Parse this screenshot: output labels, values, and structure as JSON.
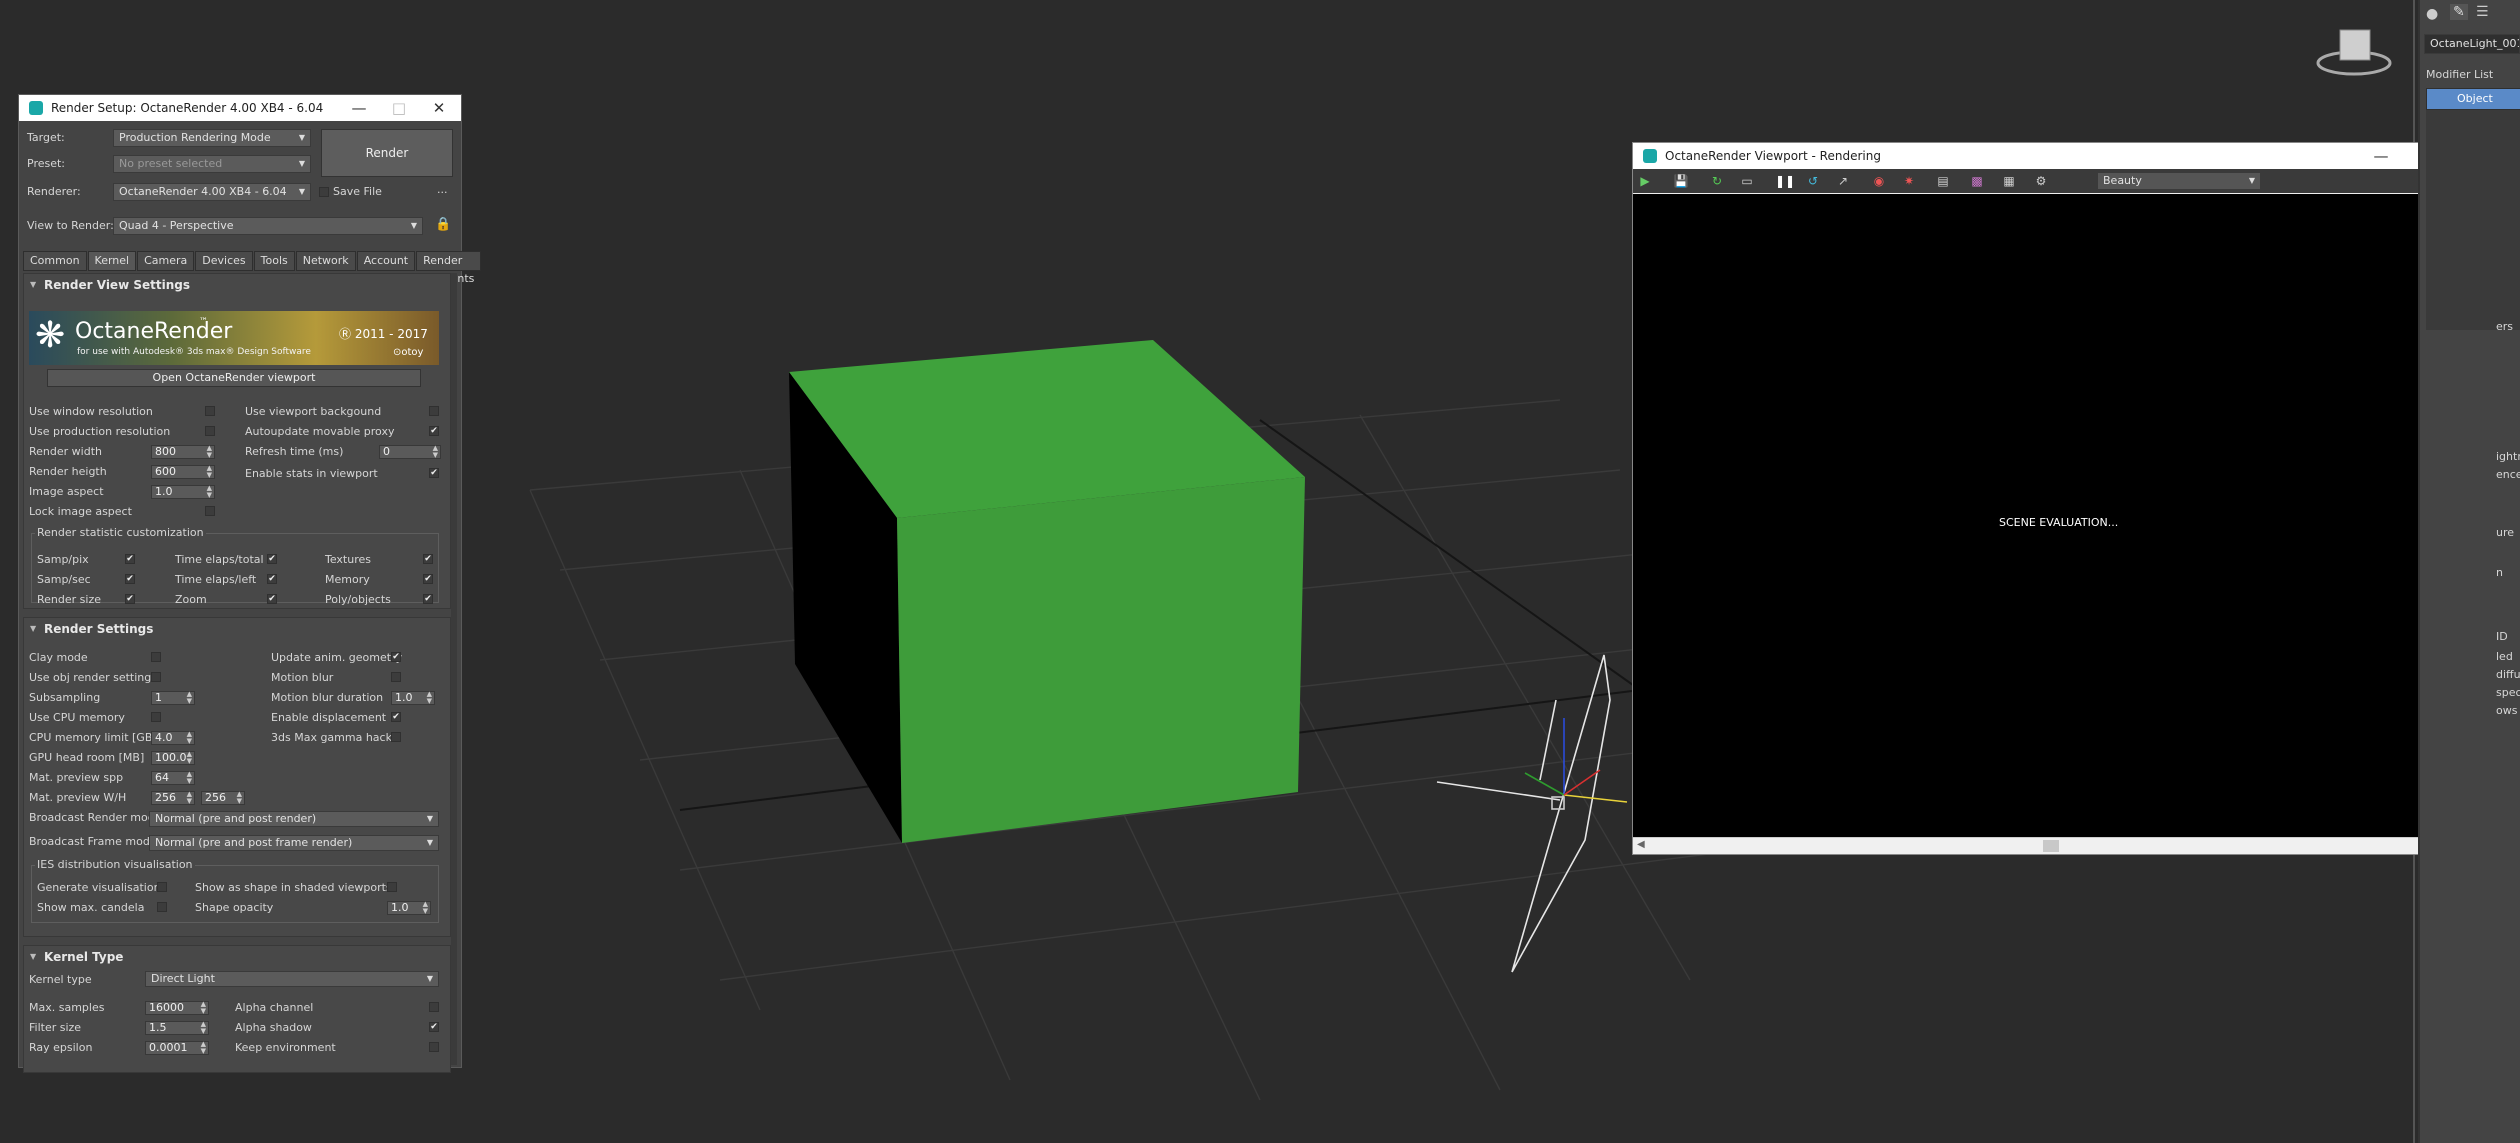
{
  "render_setup": {
    "title": "Render Setup: OctaneRender 4.00 XB4 - 6.04",
    "target_label": "Target:",
    "target_value": "Production Rendering Mode",
    "preset_label": "Preset:",
    "preset_value": "No preset selected",
    "renderer_label": "Renderer:",
    "renderer_value": "OctaneRender 4.00 XB4 - 6.04",
    "save_file": "Save File",
    "more": "...",
    "view_label": "View to Render:",
    "view_value": "Quad 4 - Perspective",
    "render_button": "Render",
    "tabs": [
      "Common",
      "Kernel",
      "Camera",
      "Devices",
      "Tools",
      "Network",
      "Account",
      "Render Elements"
    ],
    "active_tab": "Kernel",
    "render_view": {
      "heading": "Render View Settings",
      "banner_brand": "OctaneRender",
      "banner_tm": "™",
      "banner_sub": "for use with Autodesk® 3ds max® Design Software",
      "banner_years": "Ⓡ 2011 - 2017",
      "banner_otoy": "⊙otoy",
      "open_viewport": "Open OctaneRender viewport",
      "use_window_resolution": "Use window resolution",
      "use_production_resolution": "Use production resolution",
      "render_width": "Render width",
      "render_width_value": "800",
      "render_height": "Render heigth",
      "render_height_value": "600",
      "image_aspect": "Image aspect",
      "image_aspect_value": "1.0",
      "lock_image_aspect": "Lock image aspect",
      "use_viewport_background": "Use viewport backgound",
      "autoupdate_proxy": "Autoupdate movable proxy",
      "refresh_time": "Refresh time (ms)",
      "refresh_time_value": "0",
      "enable_stats": "Enable stats in viewport",
      "stats_group": "Render statistic customization",
      "stats": [
        [
          "Samp/pix",
          "Time elaps/total",
          "Textures"
        ],
        [
          "Samp/sec",
          "Time elaps/left",
          "Memory"
        ],
        [
          "Render size",
          "Zoom",
          "Poly/objects"
        ]
      ]
    },
    "render_settings": {
      "heading": "Render Settings",
      "clay_mode": "Clay mode",
      "use_obj_render": "Use obj render settings",
      "subsampling": "Subsampling",
      "subsampling_value": "1",
      "use_cpu_memory": "Use CPU memory",
      "cpu_memory_limit": "CPU memory limit [GB]",
      "cpu_memory_limit_value": "4.0",
      "gpu_headroom": "GPU head room [MB]",
      "gpu_headroom_value": "100.0",
      "mat_preview_spp": "Mat. preview spp",
      "mat_preview_spp_value": "64",
      "mat_preview_wh": "Mat. preview W/H",
      "mat_preview_w": "256",
      "mat_preview_h": "256",
      "update_anim": "Update anim. geometry",
      "motion_blur": "Motion blur",
      "motion_blur_duration": "Motion blur duration",
      "motion_blur_duration_value": "1.0",
      "enable_displacement": "Enable displacement",
      "gamma_hack": "3ds Max gamma hack",
      "broadcast_render_label": "Broadcast Render mode",
      "broadcast_render_value": "Normal (pre and post render)",
      "broadcast_frame_label": "Broadcast Frame mode",
      "broadcast_frame_value": "Normal (pre and post frame render)",
      "ies_group": "IES distribution visualisation",
      "generate_vis": "Generate visualisation",
      "show_shape": "Show as shape in shaded viewports",
      "show_candela": "Show max. candela",
      "shape_opacity": "Shape opacity",
      "shape_opacity_value": "1.0"
    },
    "kernel_type": {
      "heading": "Kernel Type",
      "kernel_label": "Kernel type",
      "kernel_value": "Direct Light",
      "max_samples": "Max. samples",
      "max_samples_value": "16000",
      "filter_size": "Filter size",
      "filter_size_value": "1.5",
      "ray_epsilon": "Ray epsilon",
      "ray_epsilon_value": "0.0001",
      "alpha_channel": "Alpha channel",
      "alpha_shadow": "Alpha shadow",
      "keep_environment": "Keep environment"
    }
  },
  "octane_viewport": {
    "title": "OctaneRender Viewport - Rendering",
    "pass_value": "Beauty",
    "status": "SCENE EVALUATION..."
  },
  "command_panel": {
    "object_name": "OctaneLight_001",
    "modifier_list": "Modifier List",
    "stack_item": "Object",
    "partial_labels": [
      "ers",
      "ightn",
      "ence p",
      "ure",
      "n",
      "ID",
      "led",
      "diffus",
      "specu",
      "ows"
    ]
  },
  "colors": {
    "cube_front": "#3e9c3a",
    "cube_top": "#3fa23c",
    "viewport_bg": "#2b2b2b",
    "accent": "#1aa7a7"
  }
}
